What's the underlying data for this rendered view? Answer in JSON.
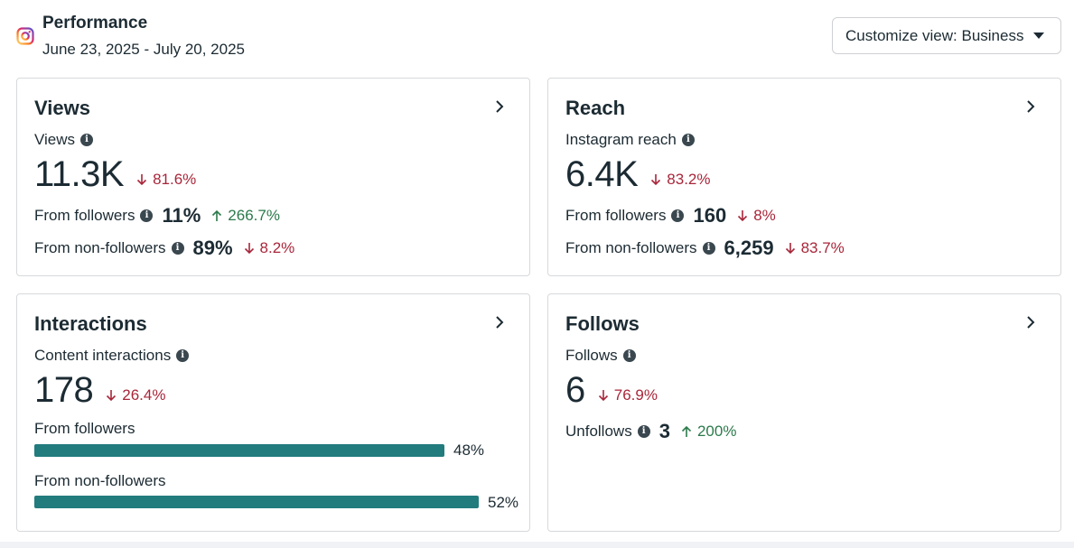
{
  "header": {
    "title": "Performance",
    "date_range": "June 23, 2025 - July 20, 2025",
    "customize_label": "Customize view: Business"
  },
  "icons": {
    "platform": "instagram-icon",
    "info": "info-icon",
    "chevron": "chevron-right-icon",
    "dropdown": "caret-down-icon"
  },
  "colors": {
    "negative": "#a8263a",
    "positive": "#2b7a4b",
    "bar": "#227b7d"
  },
  "views": {
    "title": "Views",
    "metric_label": "Views",
    "value": "11.3K",
    "change": "81.6%",
    "followers_label": "From followers",
    "followers_value": "11%",
    "followers_change": "266.7%",
    "nonfollowers_label": "From non-followers",
    "nonfollowers_value": "89%",
    "nonfollowers_change": "8.2%"
  },
  "reach": {
    "title": "Reach",
    "metric_label": "Instagram reach",
    "value": "6.4K",
    "change": "83.2%",
    "followers_label": "From followers",
    "followers_value": "160",
    "followers_change": "8%",
    "nonfollowers_label": "From non-followers",
    "nonfollowers_value": "6,259",
    "nonfollowers_change": "83.7%"
  },
  "interactions": {
    "title": "Interactions",
    "metric_label": "Content interactions",
    "value": "178",
    "change": "26.4%",
    "followers_label": "From followers",
    "followers_pct": "48%",
    "followers_fraction": 0.48,
    "nonfollowers_label": "From non-followers",
    "nonfollowers_pct": "52%",
    "nonfollowers_fraction": 0.52
  },
  "follows": {
    "title": "Follows",
    "metric_label": "Follows",
    "value": "6",
    "change": "76.9%",
    "unfollows_label": "Unfollows",
    "unfollows_value": "3",
    "unfollows_change": "200%"
  }
}
